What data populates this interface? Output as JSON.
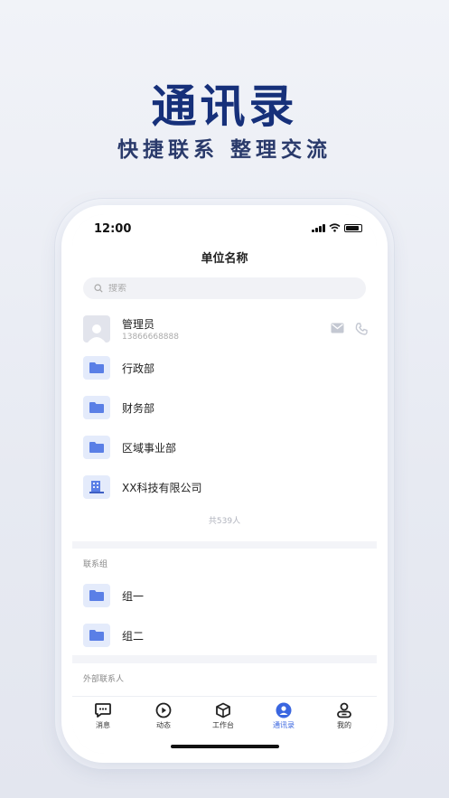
{
  "promo": {
    "headline": "通讯录",
    "subheadline": "快捷联系  整理交流"
  },
  "status_bar": {
    "time": "12:00"
  },
  "header": {
    "title": "单位名称"
  },
  "search": {
    "placeholder": "搜索"
  },
  "admin": {
    "name": "管理员",
    "phone": "13866668888"
  },
  "departments": [
    {
      "label": "行政部",
      "icon": "folder-icon"
    },
    {
      "label": "财务部",
      "icon": "folder-icon"
    },
    {
      "label": "区域事业部",
      "icon": "folder-icon"
    },
    {
      "label": "XX科技有限公司",
      "icon": "building-icon"
    }
  ],
  "total": "共539人",
  "groups": {
    "title": "联系组",
    "items": [
      {
        "label": "组一",
        "icon": "folder-icon"
      },
      {
        "label": "组二",
        "icon": "folder-icon"
      }
    ]
  },
  "external": {
    "title": "外部联系人"
  },
  "tabs": [
    {
      "label": "消息",
      "icon": "chat-icon",
      "active": false
    },
    {
      "label": "动态",
      "icon": "play-circle-icon",
      "active": false
    },
    {
      "label": "工作台",
      "icon": "cube-icon",
      "active": false
    },
    {
      "label": "通讯录",
      "icon": "contacts-icon",
      "active": true
    },
    {
      "label": "我的",
      "icon": "person-icon",
      "active": false
    }
  ],
  "colors": {
    "brand_dark": "#16307a",
    "accent_blue": "#3a66e0",
    "folder_blue": "#5a7fe6"
  }
}
